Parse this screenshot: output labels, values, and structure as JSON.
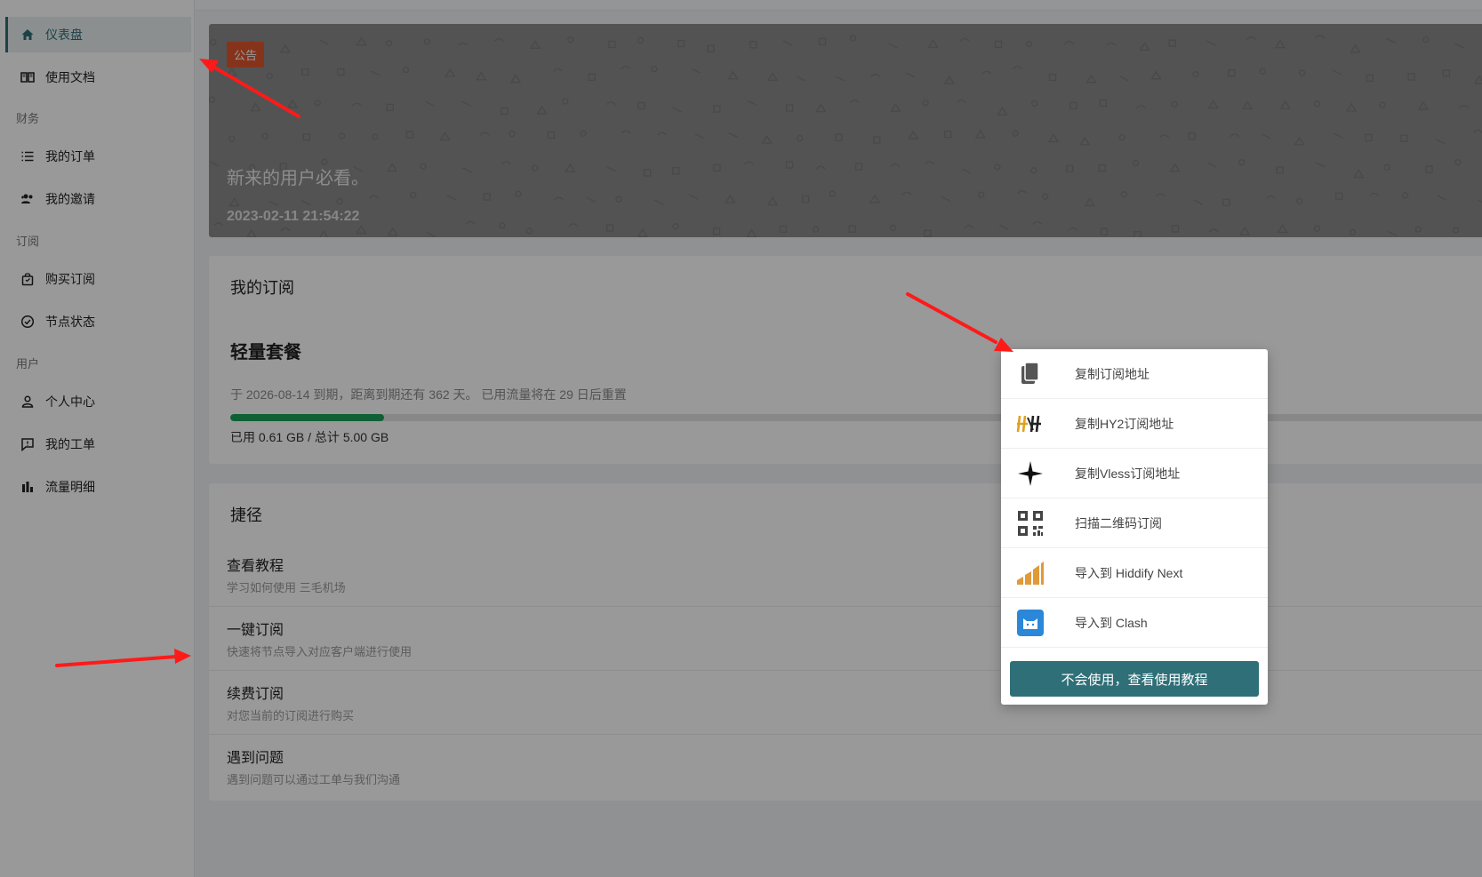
{
  "sidebar": {
    "items": [
      {
        "label": "仪表盘"
      },
      {
        "label": "使用文档"
      },
      {
        "label": "我的订单"
      },
      {
        "label": "我的邀请"
      },
      {
        "label": "购买订阅"
      },
      {
        "label": "节点状态"
      },
      {
        "label": "个人中心"
      },
      {
        "label": "我的工单"
      },
      {
        "label": "流量明细"
      }
    ],
    "sections": [
      "财务",
      "订阅",
      "用户"
    ]
  },
  "notice": {
    "tag": "公告",
    "title": "新来的用户必看。",
    "date": "2023-02-11 21:54:22"
  },
  "subscription": {
    "title": "我的订阅",
    "plan_name": "轻量套餐",
    "description": "于 2026-08-14 到期，距离到期还有 362 天。 已用流量将在 29 日后重置",
    "usage_text": "已用 0.61 GB / 总计 5.00 GB",
    "used_fraction": 0.122
  },
  "shortcuts": {
    "title": "捷径",
    "items": [
      {
        "title": "查看教程",
        "desc": "学习如何使用 三毛机场"
      },
      {
        "title": "一键订阅",
        "desc": "快速将节点导入对应客户端进行使用"
      },
      {
        "title": "续费订阅",
        "desc": "对您当前的订阅进行购买"
      },
      {
        "title": "遇到问题",
        "desc": "遇到问题可以通过工单与我们沟通"
      }
    ]
  },
  "dropdown": {
    "items": [
      {
        "label": "复制订阅地址",
        "icon": "copy-icon"
      },
      {
        "label": "复制HY2订阅地址",
        "icon": "hy2-icon"
      },
      {
        "label": "复制Vless订阅地址",
        "icon": "vless-star-icon"
      },
      {
        "label": "扫描二维码订阅",
        "icon": "qrcode-icon"
      },
      {
        "label": "导入到 Hiddify Next",
        "icon": "hiddify-icon"
      },
      {
        "label": "导入到 Clash",
        "icon": "clash-cat-icon"
      }
    ],
    "help_button": "不会使用，查看使用教程"
  },
  "colors": {
    "accent": "#2f6f77",
    "progress": "#1aa157",
    "notice_tag": "#e0552e",
    "arrow": "#ff1a1a"
  }
}
